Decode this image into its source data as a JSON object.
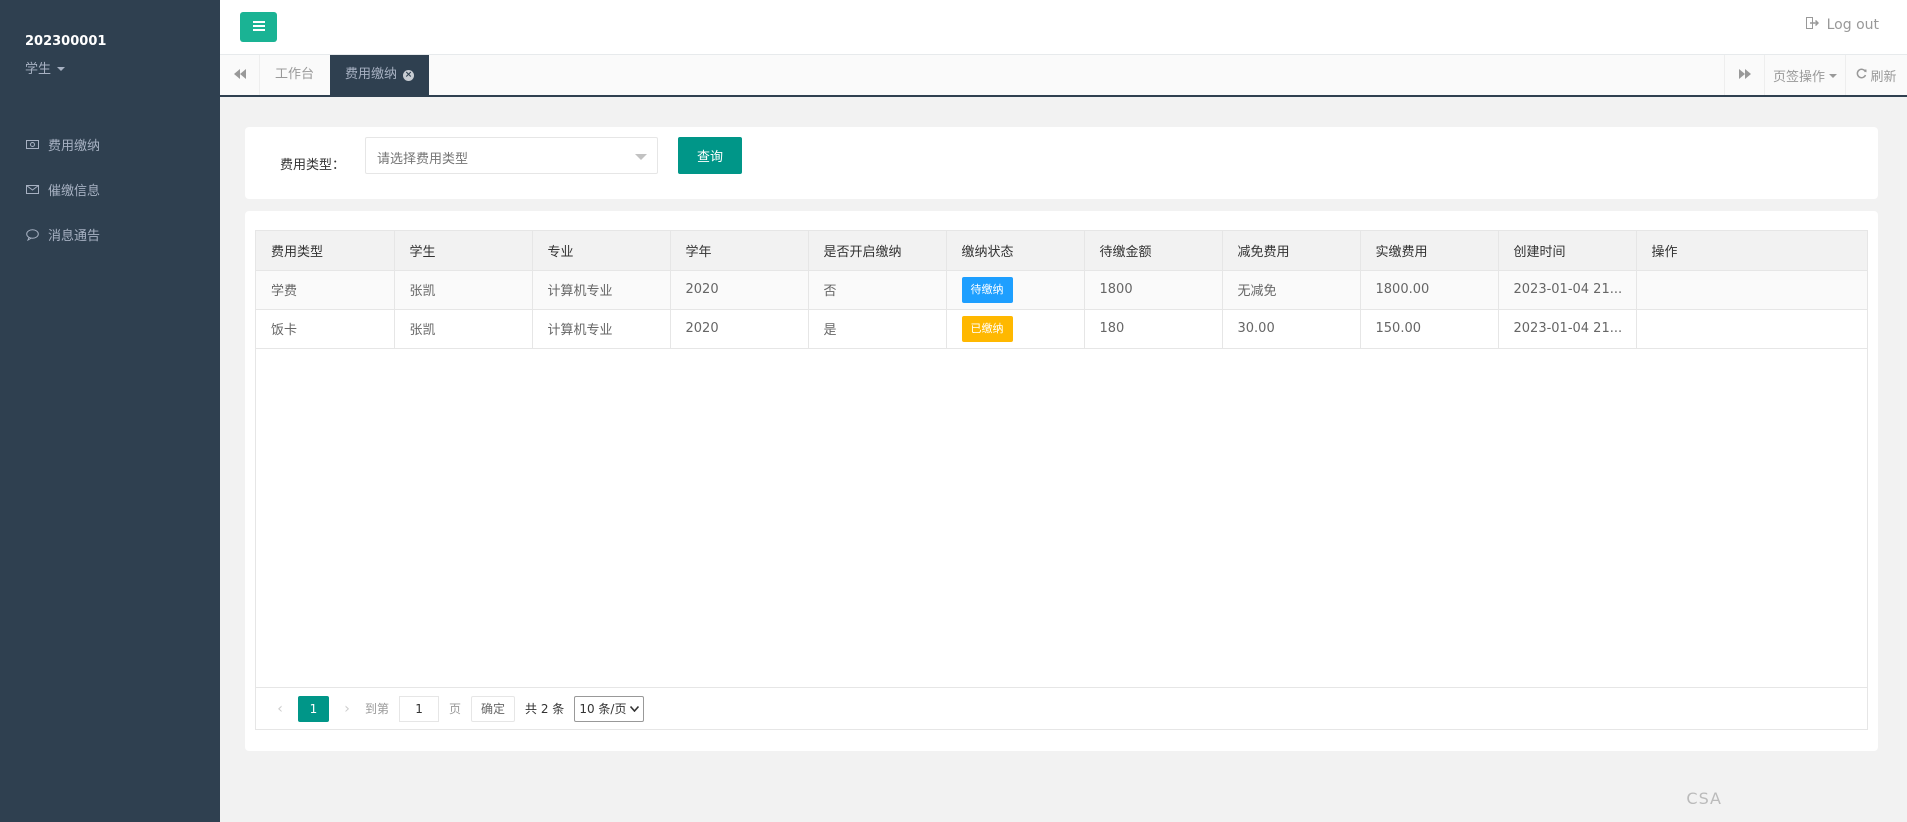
{
  "sidebar": {
    "user_id": "202300001",
    "user_role": "学生",
    "items": [
      {
        "label": "费用缴纳",
        "icon": "money-icon"
      },
      {
        "label": "催缴信息",
        "icon": "envelope-icon"
      },
      {
        "label": "消息通告",
        "icon": "comment-icon"
      }
    ]
  },
  "topbar": {
    "logout_label": "Log out"
  },
  "tabs": {
    "home": "工作台",
    "active": "费用缴纳",
    "ops_label": "页签操作",
    "refresh_label": "刷新"
  },
  "search": {
    "label": "费用类型：",
    "placeholder": "请选择费用类型",
    "button_label": "查询"
  },
  "table": {
    "headers": [
      "费用类型",
      "学生",
      "专业",
      "学年",
      "是否开启缴纳",
      "缴纳状态",
      "待缴金额",
      "减免费用",
      "实缴费用",
      "创建时间",
      "操作"
    ],
    "rows": [
      {
        "type": "学费",
        "student": "张凯",
        "major": "计算机专业",
        "year": "2020",
        "open": "否",
        "status": "待缴纳",
        "due": "1800",
        "waived": "无减免",
        "paid": "1800.00",
        "created": "2023-01-04 21..."
      },
      {
        "type": "饭卡",
        "student": "张凯",
        "major": "计算机专业",
        "year": "2020",
        "open": "是",
        "status": "已缴纳",
        "due": "180",
        "waived": "30.00",
        "paid": "150.00",
        "created": "2023-01-04 21..."
      }
    ]
  },
  "pager": {
    "current": "1",
    "goto_label": "到第",
    "goto_value": "1",
    "page_label": "页",
    "confirm_label": "确定",
    "total_label": "共 2 条",
    "per_page": "10 条/页"
  },
  "watermark": "CSA",
  "colors": {
    "sidebar_bg": "#2f4050",
    "accent": "#009688",
    "menu_btn": "#1ab394",
    "badge_pending": "#1e9fff",
    "badge_paid": "#ffb800"
  }
}
